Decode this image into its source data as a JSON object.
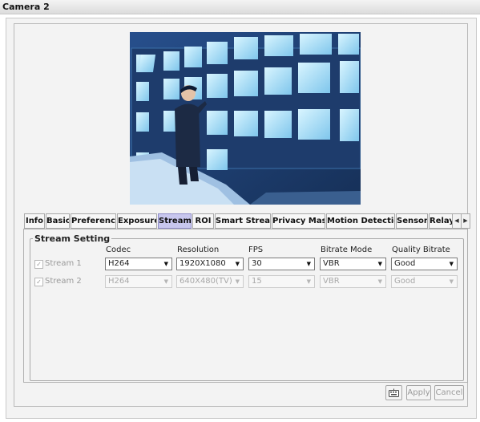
{
  "window": {
    "title": "Camera 2"
  },
  "preview": {
    "alt": "camera preview: control room with monitor wall"
  },
  "tabs": [
    {
      "label": "Info",
      "active": false
    },
    {
      "label": "Basic",
      "active": false
    },
    {
      "label": "Preference",
      "active": false
    },
    {
      "label": "Exposure",
      "active": false
    },
    {
      "label": "Stream",
      "active": true
    },
    {
      "label": "ROI",
      "active": false
    },
    {
      "label": "Smart Stream",
      "active": false
    },
    {
      "label": "Privacy Mask",
      "active": false
    },
    {
      "label": "Motion Detection",
      "active": false
    },
    {
      "label": "Sensor",
      "active": false
    },
    {
      "label": "Relay",
      "active": false
    }
  ],
  "tab_scroll": {
    "left_icon": "scroll-left-icon",
    "right_icon": "scroll-right-icon"
  },
  "stream_setting": {
    "title": "Stream Setting",
    "columns": {
      "codec": "Codec",
      "resolution": "Resolution",
      "fps": "FPS",
      "bitrate_mode": "Bitrate Mode",
      "quality_bitrate": "Quality Bitrate"
    },
    "rows": [
      {
        "label": "Stream 1",
        "checked": true,
        "enabled": true,
        "codec": "H264",
        "resolution": "1920X1080",
        "fps": "30",
        "bitrate_mode": "VBR",
        "quality_bitrate": "Good"
      },
      {
        "label": "Stream 2",
        "checked": true,
        "enabled": false,
        "codec": "H264",
        "resolution": "640X480(TV)",
        "fps": "15",
        "bitrate_mode": "VBR",
        "quality_bitrate": "Good"
      }
    ]
  },
  "buttons": {
    "keyboard_icon": "keyboard-icon",
    "apply": "Apply",
    "cancel": "Cancel"
  },
  "colors": {
    "active_tab": "#c8c7ee",
    "panel_bg": "#f3f3f3",
    "disabled_text": "#a8a8a8"
  }
}
